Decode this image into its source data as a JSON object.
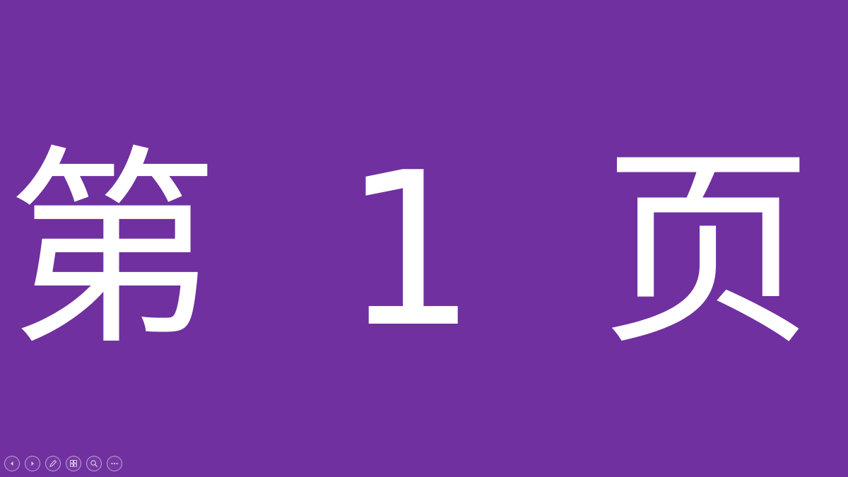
{
  "slide": {
    "title": "第 1 页",
    "background_color": "#7030a0",
    "text_color": "#ffffff"
  },
  "toolbar": {
    "buttons": [
      {
        "icon": "previous-icon"
      },
      {
        "icon": "next-icon"
      },
      {
        "icon": "pen-icon"
      },
      {
        "icon": "slide-sorter-icon"
      },
      {
        "icon": "zoom-icon"
      },
      {
        "icon": "more-options-icon"
      }
    ]
  }
}
